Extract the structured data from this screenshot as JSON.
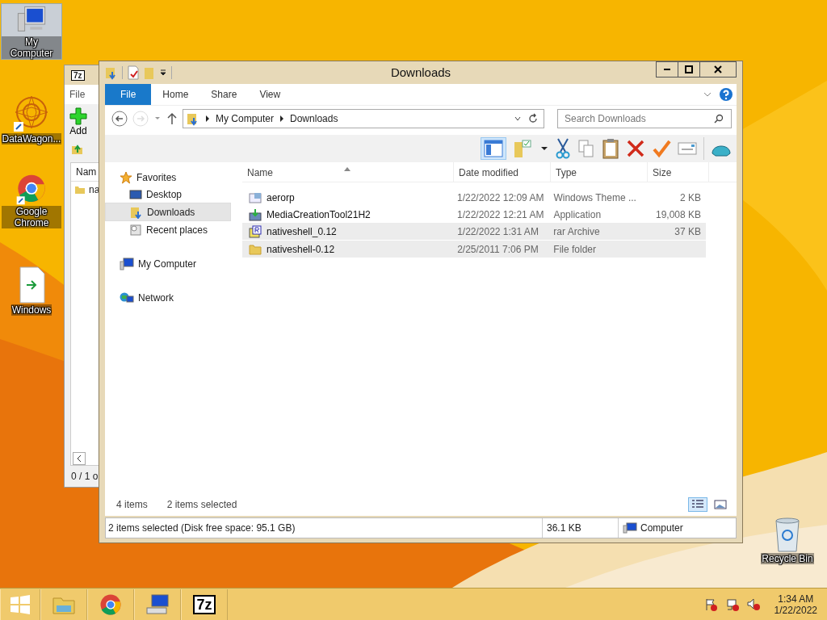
{
  "desktop_icons": [
    {
      "label": "My Computer",
      "kind": "computer",
      "selected": true
    },
    {
      "label": "DataWagon...",
      "kind": "mandala",
      "selected": false
    },
    {
      "label": "Google Chrome",
      "kind": "chrome",
      "selected": false
    },
    {
      "label": "Windows",
      "kind": "document",
      "selected": false
    }
  ],
  "recycle_bin": {
    "label": "Recycle Bin"
  },
  "back_window": {
    "icon_label": "7z",
    "menu": "File",
    "add_label": "Add",
    "column": "Nam",
    "row": "na",
    "status": "0 / 1 o"
  },
  "explorer": {
    "title": "Downloads",
    "ribbon_tabs": [
      {
        "label": "File",
        "kind": "file",
        "selected": false
      },
      {
        "label": "Home",
        "kind": "tab",
        "selected": false
      },
      {
        "label": "Share",
        "kind": "tab",
        "selected": false
      },
      {
        "label": "View",
        "kind": "tab",
        "selected": false
      }
    ],
    "path": [
      "My Computer",
      "Downloads"
    ],
    "search": {
      "placeholder": "Search Downloads"
    },
    "nav": [
      {
        "label": "Favorites",
        "kind": "favorites",
        "selected": false,
        "children": [
          {
            "label": "Desktop",
            "kind": "desktop",
            "selected": false
          },
          {
            "label": "Downloads",
            "kind": "downloads",
            "selected": true
          },
          {
            "label": "Recent places",
            "kind": "recent",
            "selected": false
          }
        ]
      },
      {
        "label": "My Computer",
        "kind": "computer",
        "selected": false
      },
      {
        "label": "Network",
        "kind": "network",
        "selected": false
      }
    ],
    "columns": [
      "Name",
      "Date modified",
      "Type",
      "Size"
    ],
    "rows": [
      {
        "name": "aerorp",
        "date": "1/22/2022 12:09 AM",
        "type": "Windows Theme ...",
        "size": "2 KB",
        "kind": "theme",
        "selected": false
      },
      {
        "name": "MediaCreationTool21H2",
        "date": "1/22/2022 12:21 AM",
        "type": "Application",
        "size": "19,008 KB",
        "kind": "app",
        "selected": false
      },
      {
        "name": "nativeshell_0.12",
        "date": "1/22/2022 1:31 AM",
        "type": "rar Archive",
        "size": "37 KB",
        "kind": "archive",
        "selected": true
      },
      {
        "name": "nativeshell-0.12",
        "date": "2/25/2011 7:06 PM",
        "type": "File folder",
        "size": "",
        "kind": "folder",
        "selected": true
      }
    ],
    "item_count": "4 items",
    "selected_count": "2 items selected",
    "status_bar": {
      "text": "2 items selected (Disk free space: 95.1 GB)",
      "size": "36.1 KB",
      "location": "Computer"
    }
  },
  "taskbar": {
    "apps": [
      {
        "kind": "explorer"
      },
      {
        "kind": "chrome"
      },
      {
        "kind": "computer"
      },
      {
        "kind": "sevenzip",
        "label": "7z"
      }
    ],
    "time": "1:34 AM",
    "date": "1/22/2022"
  }
}
